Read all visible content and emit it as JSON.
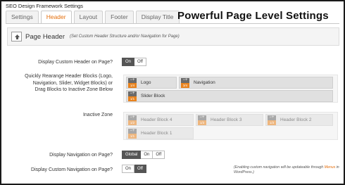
{
  "window_title": "SEO Design Framework Settings",
  "tabs": [
    {
      "label": "Settings"
    },
    {
      "label": "Header"
    },
    {
      "label": "Layout"
    },
    {
      "label": "Footer"
    },
    {
      "label": "Display Title"
    }
  ],
  "promo_heading": "Powerful Page Level Settings",
  "section": {
    "title": "Page Header",
    "subtitle": "(Set Custom Header Structure and/or Navigation for Page)"
  },
  "display_custom_header": {
    "label": "Display Custom Header on Page?",
    "on": "On",
    "off": "Off",
    "selected": "On"
  },
  "rearrange": {
    "label": "Quickly Rearange Header Blocks (Logo, Navigation, Slider, Widget Blocks) or Drag Blocks to Inactive Zone Below"
  },
  "active_blocks": [
    {
      "label": "Logo",
      "fraction": "1/4"
    },
    {
      "label": "Navigation",
      "fraction": "3/4"
    },
    {
      "label": "Slider Block",
      "fraction": "1/1"
    }
  ],
  "inactive_zone": {
    "label": "Inactive Zone",
    "blocks": [
      {
        "label": "Header Block 4",
        "fraction": "1/2"
      },
      {
        "label": "Header Block 3",
        "fraction": "1/3"
      },
      {
        "label": "Header Block 2",
        "fraction": "1/3"
      },
      {
        "label": "Header Block 1",
        "fraction": "1/1"
      }
    ]
  },
  "display_navigation": {
    "label": "Display Navigation on Page?",
    "options": [
      "Global",
      "On",
      "Off"
    ],
    "selected": "Global"
  },
  "display_custom_navigation": {
    "label": "Display Custom Navigation on Page?",
    "options": [
      "On",
      "Off"
    ],
    "selected": "Off"
  },
  "note": {
    "before": "(Enabling custom navigation will be updateable through ",
    "link": "Menus",
    "after": " in WordPress.)"
  },
  "block_controls": {
    "minus": "−",
    "plus": "+"
  },
  "colors": {
    "accent": "#e46f0d",
    "badge": "#e8821d",
    "selected": "#555555"
  }
}
